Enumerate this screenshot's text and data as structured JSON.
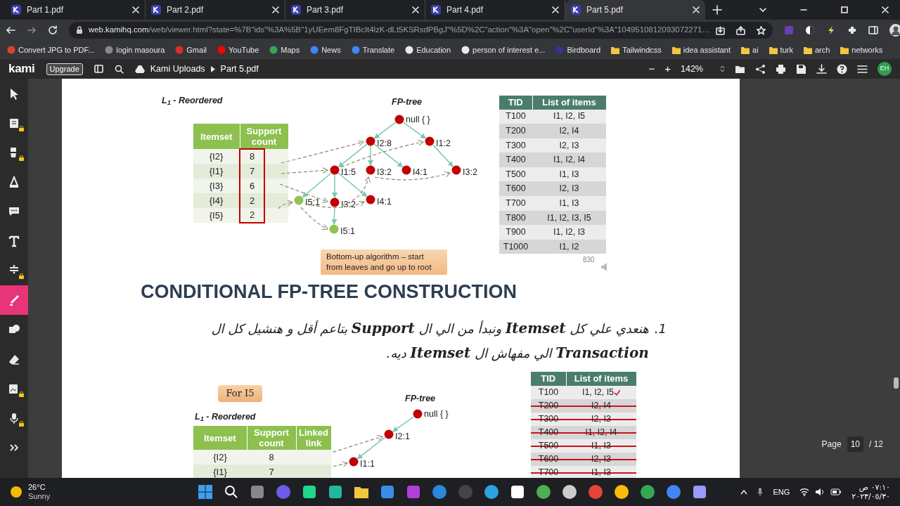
{
  "browser": {
    "tabs": [
      {
        "title": "Part 1.pdf",
        "selected": false
      },
      {
        "title": "Part 2.pdf",
        "selected": false
      },
      {
        "title": "Part 3.pdf",
        "selected": false
      },
      {
        "title": "Part 4.pdf",
        "selected": false
      },
      {
        "title": "Part 5.pdf",
        "selected": true
      }
    ],
    "url_host": "web.kamihq.com",
    "url_path": "/web/viewer.html?state=%7B\"ids\"%3A%5B\"1yUEem8FgTIBcIt4lzK-dLt5KSRsdPBgJ\"%5D%2C\"action\"%3A\"open\"%2C\"userId\"%3A\"1049510812093072271…",
    "bookmarks": [
      {
        "label": "Convert JPG to PDF...",
        "kind": "site"
      },
      {
        "label": "login masoura",
        "kind": "site"
      },
      {
        "label": "Gmail",
        "kind": "site"
      },
      {
        "label": "YouTube",
        "kind": "site"
      },
      {
        "label": "Maps",
        "kind": "site"
      },
      {
        "label": "News",
        "kind": "site"
      },
      {
        "label": "Translate",
        "kind": "site"
      },
      {
        "label": "Education",
        "kind": "site"
      },
      {
        "label": "person of interest e...",
        "kind": "site"
      },
      {
        "label": "Birdboard",
        "kind": "site"
      },
      {
        "label": "Tailwindcss",
        "kind": "folder"
      },
      {
        "label": "idea assistant",
        "kind": "folder"
      },
      {
        "label": "ai",
        "kind": "folder"
      },
      {
        "label": "turk",
        "kind": "folder"
      },
      {
        "label": "arch",
        "kind": "folder"
      },
      {
        "label": "networks",
        "kind": "folder"
      }
    ]
  },
  "kami_bar": {
    "logo": "kami",
    "upgrade": "Upgrade",
    "breadcrumb": [
      "Kami Uploads",
      "Part 5.pdf"
    ],
    "zoom_out": "−",
    "zoom_in": "+",
    "zoom": "142%",
    "avatar": "EH"
  },
  "tools": [
    {
      "kind": "select",
      "selected": false,
      "locked": false
    },
    {
      "kind": "note",
      "selected": false,
      "locked": true
    },
    {
      "kind": "media",
      "selected": false,
      "locked": true
    },
    {
      "kind": "markup",
      "selected": false,
      "locked": false
    },
    {
      "kind": "comment",
      "selected": false,
      "locked": false
    },
    {
      "kind": "text",
      "selected": false,
      "locked": false
    },
    {
      "kind": "equation",
      "selected": false,
      "locked": true
    },
    {
      "kind": "pen",
      "selected": true,
      "locked": false
    },
    {
      "kind": "shape",
      "selected": false,
      "locked": false
    },
    {
      "kind": "eraser",
      "selected": false,
      "locked": false
    },
    {
      "kind": "image",
      "selected": false,
      "locked": true
    },
    {
      "kind": "audio",
      "selected": false,
      "locked": true
    },
    {
      "kind": "expand",
      "selected": false,
      "locked": false
    }
  ],
  "slide1": {
    "l1_title": "L$_{1}$ - Reordered",
    "fp_title": "FP-tree",
    "itemset_table": {
      "columns": [
        "Itemset",
        "Support count"
      ],
      "rows": [
        [
          "{I2}",
          "8"
        ],
        [
          "{I1}",
          "7"
        ],
        [
          "{I3}",
          "6"
        ],
        [
          "{I4}",
          "2"
        ],
        [
          "{I5}",
          "2"
        ]
      ]
    },
    "fp_tree": {
      "label": "null { }",
      "color": "#c00000",
      "children": [
        {
          "label": "I2:8",
          "color": "#c00000",
          "children": [
            {
              "label": "I1:5",
              "color": "#c00000",
              "children": [
                {
                  "label": "I5:1",
                  "color": "#8fc454"
                },
                {
                  "label": "I3:2",
                  "color": "#c00000",
                  "children": [
                    {
                      "label": "I5:1",
                      "color": "#8fc454"
                    }
                  ]
                },
                {
                  "label": "I4:1",
                  "color": "#c00000"
                }
              ]
            },
            {
              "label": "I3:2",
              "color": "#c00000"
            },
            {
              "label": "I4:1",
              "color": "#c00000"
            }
          ]
        },
        {
          "label": "I1:2",
          "color": "#c00000",
          "children": [
            {
              "label": "I3:2",
              "color": "#c00000"
            }
          ]
        }
      ]
    },
    "note": "Bottom-up algorithm – start from leaves and go up to root",
    "tid_table": {
      "columns": [
        "TID",
        "List of items"
      ],
      "rows": [
        [
          "T100",
          "I1, I2, I5"
        ],
        [
          "T200",
          "I2, I4"
        ],
        [
          "T300",
          "I2, I3"
        ],
        [
          "T400",
          "I1, I2, I4"
        ],
        [
          "T500",
          "I1, I3"
        ],
        [
          "T600",
          "I2, I3"
        ],
        [
          "T700",
          "I1, I3"
        ],
        [
          "T800",
          "I1, I2, I3, I5"
        ],
        [
          "T900",
          "I1, I2, I3"
        ],
        [
          "T1000",
          "I1, I2"
        ]
      ]
    },
    "slide_number": "830"
  },
  "heading": "CONDITIONAL FP-TREE CONSTRUCTION",
  "steps": [
    {
      "number": "1.",
      "text": "هنعدي علي كل **Itemset** ونبدأ من الي ال **Support** بتاعم أقل و هنشيل كل ال **Transaction** الي مفهاش ال **Itemset** ديه."
    }
  ],
  "slide2": {
    "badge": "For I5",
    "fp_title": "FP-tree",
    "l1_title": "L$_{1}$ - Reordered",
    "itemset_table": {
      "columns": [
        "Itemset",
        "Support count",
        "Linked link"
      ],
      "rows": [
        [
          "{I2}",
          "8"
        ],
        [
          "{I1}",
          "7"
        ]
      ]
    },
    "fp_tree": {
      "label": "null { }",
      "color": "#c00000",
      "children": [
        {
          "label": "I2:1",
          "color": "#c00000",
          "children": [
            {
              "label": "I1:1",
              "color": "#c00000"
            }
          ]
        }
      ]
    },
    "tid_table": {
      "columns": [
        "TID",
        "List of items"
      ],
      "rows": [
        {
          "cells": [
            "T100",
            "I1, I2, I5"
          ],
          "struck": false,
          "ticked": true
        },
        {
          "cells": [
            "T200",
            "I2, I4"
          ],
          "struck": true,
          "ticked": false
        },
        {
          "cells": [
            "T300",
            "I2, I3"
          ],
          "struck": true,
          "ticked": false
        },
        {
          "cells": [
            "T400",
            "I1, I2, I4"
          ],
          "struck": true,
          "ticked": false
        },
        {
          "cells": [
            "T500",
            "I1, I3"
          ],
          "struck": true,
          "ticked": false
        },
        {
          "cells": [
            "T600",
            "I2, I3"
          ],
          "struck": true,
          "ticked": false
        },
        {
          "cells": [
            "T700",
            "I1, I3"
          ],
          "struck": true,
          "ticked": false
        }
      ]
    }
  },
  "pager": {
    "label": "Page",
    "current": "10",
    "total": "/ 12"
  },
  "taskbar": {
    "temperature": "26°C",
    "weather": "Sunny",
    "language": "ENG",
    "time": "٠٧:١٠ ص",
    "date": "٢٠٢٣/٠٥/٣٠"
  }
}
